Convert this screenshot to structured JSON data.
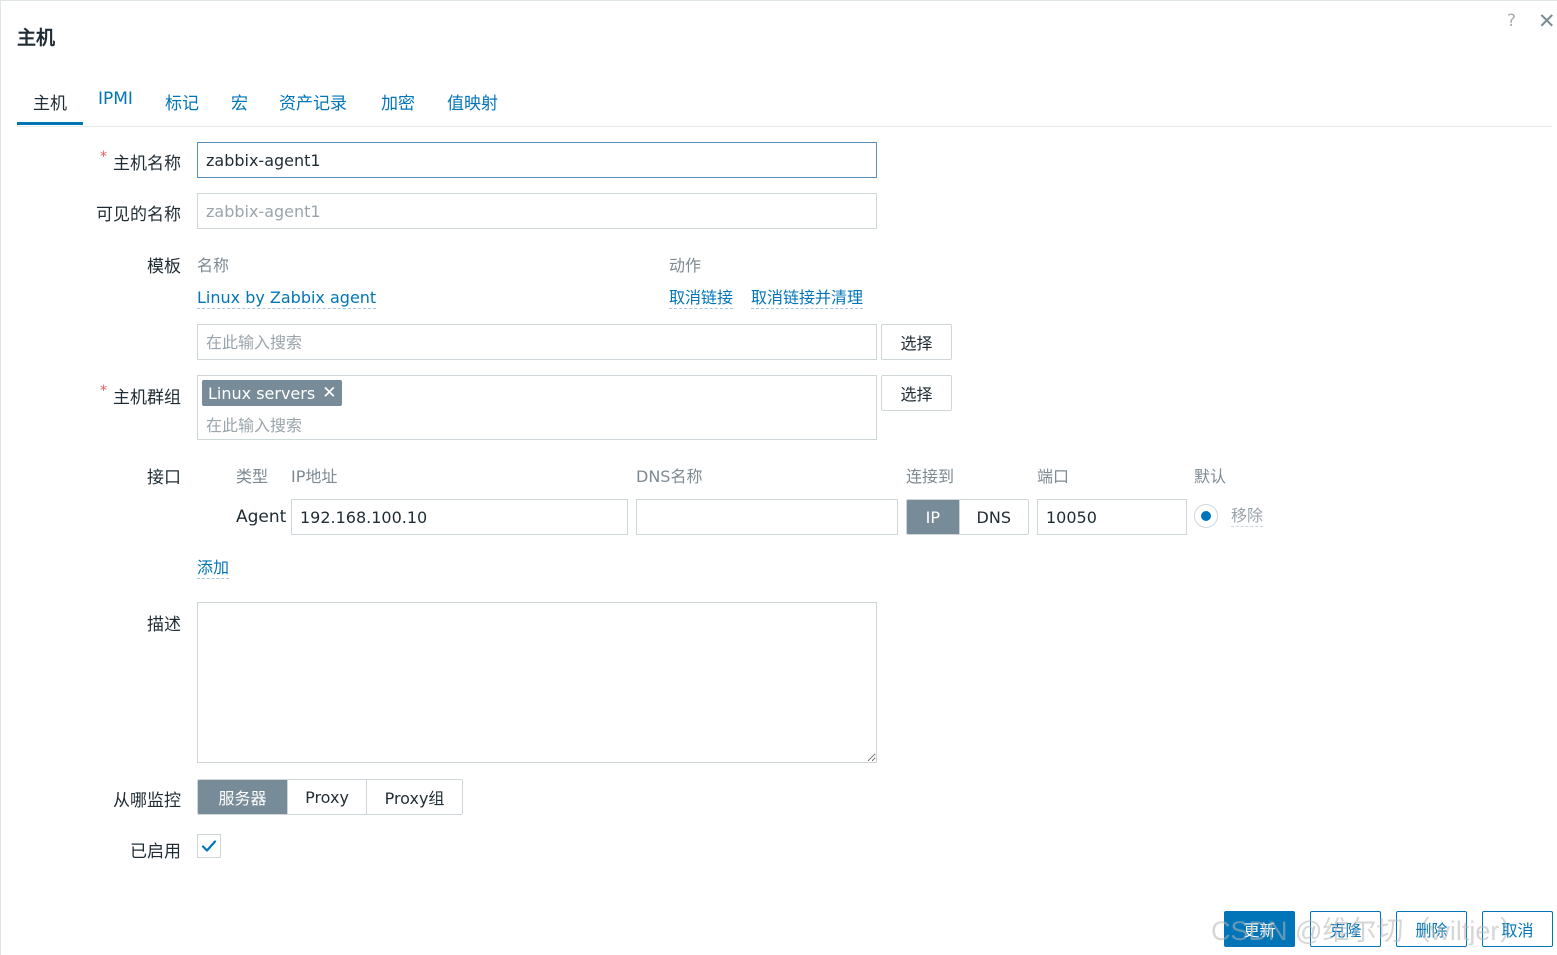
{
  "dialog": {
    "title": "主机",
    "help": "?",
    "close": "✕"
  },
  "tabs": [
    "主机",
    "IPMI",
    "标记",
    "宏",
    "资产记录",
    "加密",
    "值映射"
  ],
  "form": {
    "host_name": {
      "label": "主机名称",
      "required": "*",
      "value": "zabbix-agent1"
    },
    "visible_name": {
      "label": "可见的名称",
      "placeholder": "zabbix-agent1"
    },
    "templates": {
      "label": "模板",
      "col_name": "名称",
      "col_action": "动作",
      "linked_template": "Linux by Zabbix agent",
      "unlink": "取消链接",
      "unlink_clear": "取消链接并清理",
      "search_placeholder": "在此输入搜索",
      "select_button": "选择"
    },
    "host_groups": {
      "label": "主机群组",
      "required": "*",
      "chip": "Linux servers",
      "chip_remove": "✕",
      "search_placeholder": "在此输入搜索",
      "select_button": "选择"
    },
    "interfaces": {
      "label": "接口",
      "headers": {
        "type": "类型",
        "ip": "IP地址",
        "dns": "DNS名称",
        "connect": "连接到",
        "port": "端口",
        "default": "默认"
      },
      "rows": [
        {
          "type": "Agent",
          "ip": "192.168.100.10",
          "dns": "",
          "connect_ip": "IP",
          "connect_dns": "DNS",
          "port": "10050",
          "remove": "移除"
        }
      ],
      "add": "添加"
    },
    "description": {
      "label": "描述",
      "value": ""
    },
    "monitored_by": {
      "label": "从哪监控",
      "options": [
        "服务器",
        "Proxy",
        "Proxy组"
      ],
      "selected": "服务器"
    },
    "enabled": {
      "label": "已启用",
      "checked": true
    }
  },
  "footer": {
    "update": "更新",
    "clone": "克隆",
    "delete": "删除",
    "cancel": "取消"
  },
  "watermark": "CSDN @维尔切（wiltjer）",
  "colors": {
    "accent": "#0275b8",
    "chip": "#778c98",
    "required": "#e45959"
  }
}
